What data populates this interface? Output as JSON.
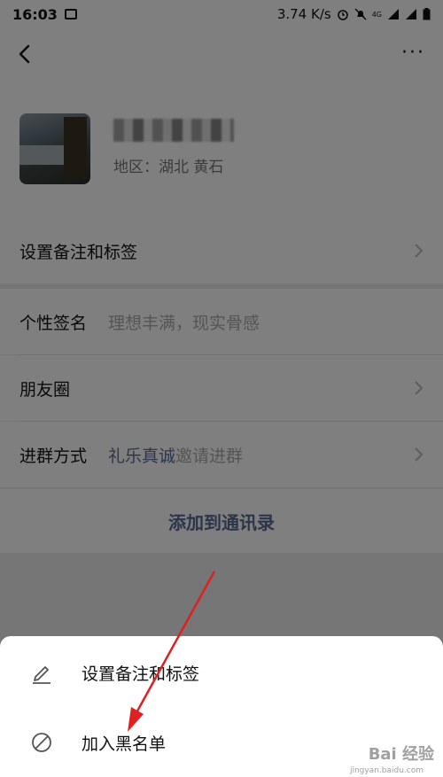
{
  "status_bar": {
    "time": "16:03",
    "speed": "3.74 K/s",
    "network": "4G"
  },
  "nav": {
    "back_icon": "chevron-left-icon",
    "more_icon": "more-icon",
    "more_text": "···"
  },
  "profile": {
    "region": "地区：湖北 黄石"
  },
  "cells": {
    "remark": {
      "label": "设置备注和标签"
    },
    "signature": {
      "label": "个性签名",
      "value": "理想丰满，现实骨感"
    },
    "moments": {
      "label": "朋友圈"
    },
    "join_group": {
      "label": "进群方式",
      "link": "礼乐真诚",
      "suffix": "邀请进群"
    }
  },
  "add_contact": {
    "label": "添加到通讯录"
  },
  "action_sheet": {
    "items": [
      {
        "label": "设置备注和标签",
        "icon": "pencil-icon"
      },
      {
        "label": "加入黑名单",
        "icon": "block-icon"
      }
    ]
  },
  "annotation": {
    "color": "#e02020"
  },
  "watermark": {
    "text": "Bai 经验",
    "sub": "jingyan.baidu.com"
  }
}
